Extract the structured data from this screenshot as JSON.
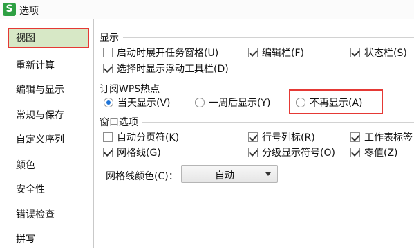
{
  "window": {
    "title": "选项",
    "icon_letter": "S"
  },
  "sidebar": {
    "items": [
      {
        "label": "视图",
        "selected": true
      },
      {
        "label": "重新计算"
      },
      {
        "label": "编辑与显示"
      },
      {
        "label": "常规与保存"
      },
      {
        "label": "自定义序列"
      },
      {
        "label": "颜色"
      },
      {
        "label": "安全性"
      },
      {
        "label": "错误检查"
      },
      {
        "label": "拼写"
      }
    ]
  },
  "display": {
    "title": "显示",
    "options": [
      {
        "label": "启动时展开任务窗格(U)",
        "checked": false
      },
      {
        "label": "编辑栏(F)",
        "checked": true
      },
      {
        "label": "状态栏(S)",
        "checked": true
      },
      {
        "label": "选择时显示浮动工具栏(D)",
        "checked": true
      }
    ]
  },
  "wps_hot": {
    "title": "订阅WPS热点",
    "options": [
      {
        "label": "当天显示(V)",
        "checked": true
      },
      {
        "label": "一周后显示(Y)",
        "checked": false
      },
      {
        "label": "不再显示(A)",
        "checked": false
      }
    ]
  },
  "window_options": {
    "title": "窗口选项",
    "options": [
      {
        "label": "自动分页符(K)",
        "checked": false
      },
      {
        "label": "行号列标(R)",
        "checked": true
      },
      {
        "label": "工作表标签",
        "checked": true
      },
      {
        "label": "网格线(G)",
        "checked": true
      },
      {
        "label": "分级显示符号(O)",
        "checked": true
      },
      {
        "label": "零值(Z)",
        "checked": true
      }
    ]
  },
  "gridline_color": {
    "label": "网格线颜色(C)：",
    "value": "自动"
  },
  "colors": {
    "highlight": "#e53935",
    "selected_bg": "#d7e8c6",
    "radio_dot": "#1e74d8",
    "app_icon": "#2ea043"
  }
}
